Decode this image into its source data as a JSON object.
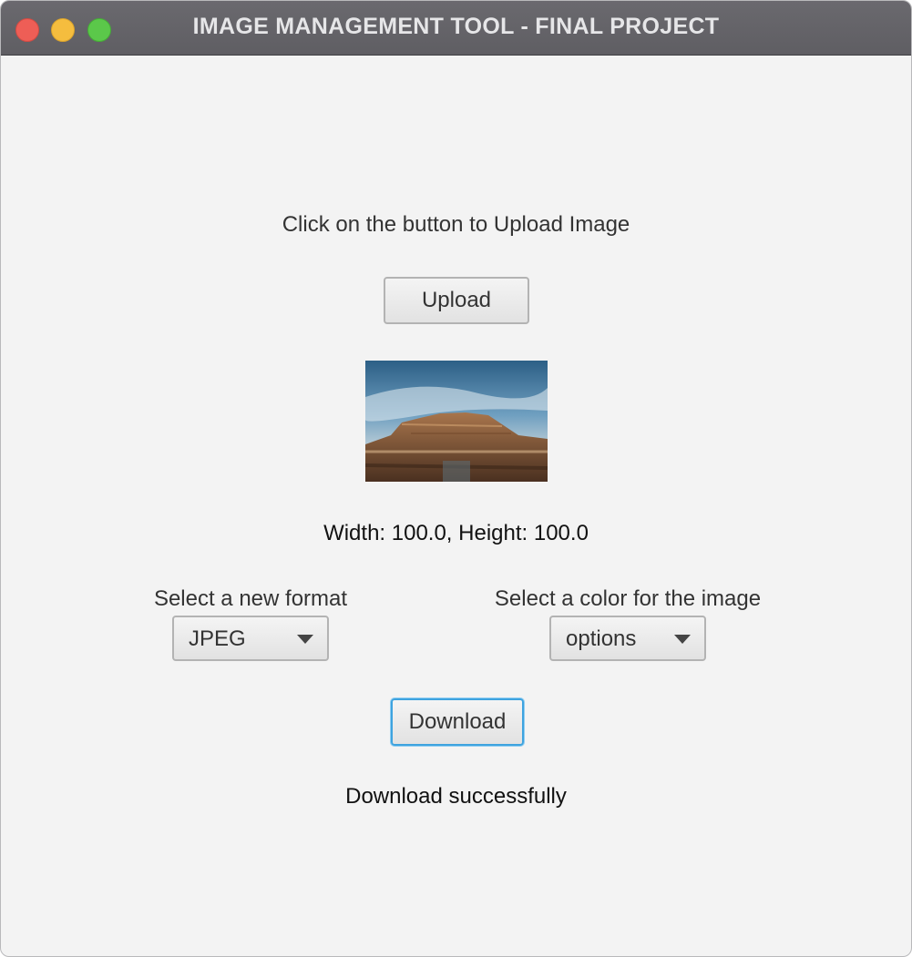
{
  "window": {
    "title": "IMAGE MANAGEMENT TOOL - FINAL PROJECT"
  },
  "upload": {
    "prompt": "Click on the button to Upload Image",
    "button_label": "Upload"
  },
  "image_info": {
    "dimensions_text": "Width: 100.0, Height: 100.0"
  },
  "format": {
    "label": "Select a new format",
    "selected": "JPEG"
  },
  "color": {
    "label": "Select a color for the image",
    "selected": "options"
  },
  "download": {
    "button_label": "Download",
    "status": "Download successfully"
  },
  "colors": {
    "titlebar": "#626166",
    "background": "#f3f3f3",
    "focus_ring": "#3ea3df"
  }
}
